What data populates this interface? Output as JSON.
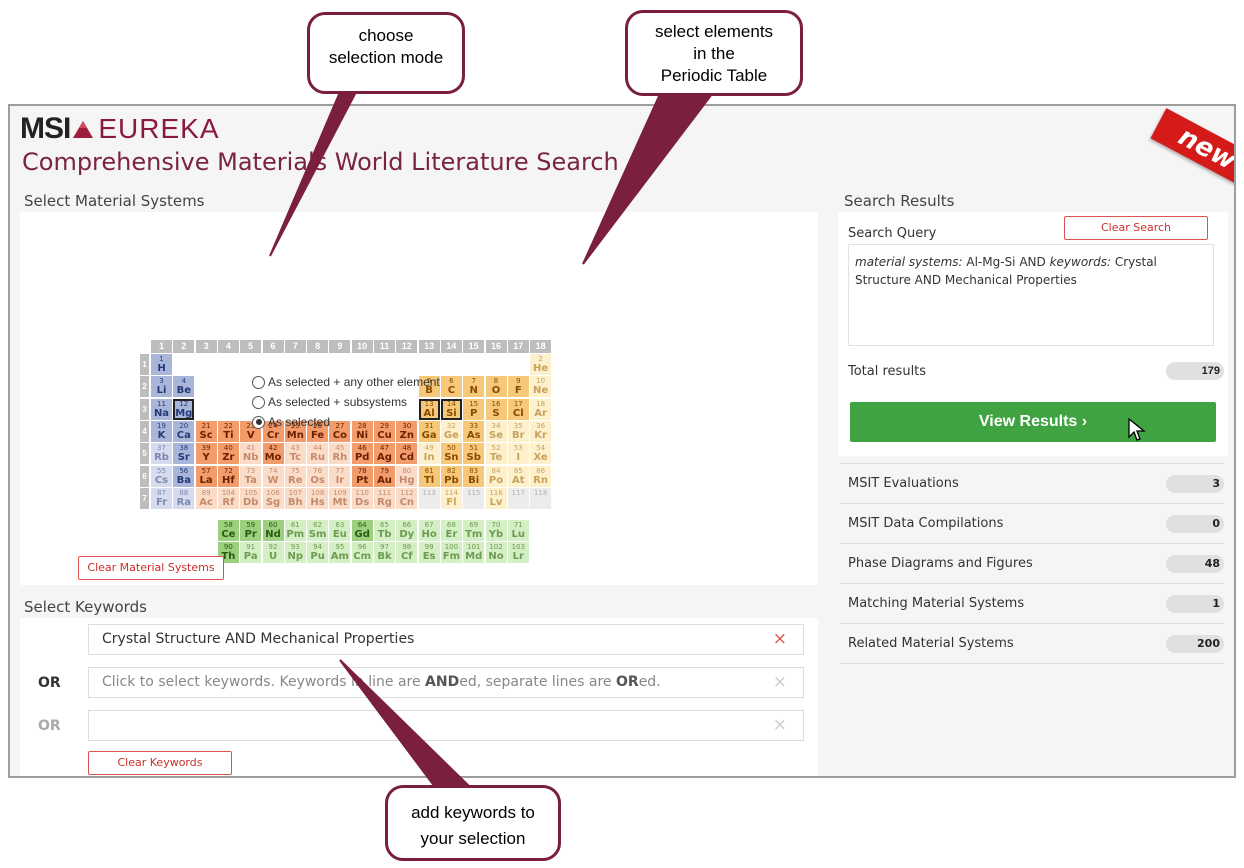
{
  "app": {
    "logo_msi": "MSI",
    "logo_eureka": "EUREKA",
    "tagline": "Comprehensive Materials World Literature Search",
    "badge": "new"
  },
  "material_systems": {
    "title": "Select Material Systems",
    "clear_label": "Clear Material Systems",
    "modes": [
      {
        "label": "As selected + any other element",
        "selected": false
      },
      {
        "label": "As selected + subsystems",
        "selected": false
      },
      {
        "label": "As selected",
        "selected": true
      }
    ],
    "group_numbers": [
      "1",
      "2",
      "3",
      "4",
      "5",
      "6",
      "7",
      "8",
      "9",
      "10",
      "11",
      "12",
      "13",
      "14",
      "15",
      "16",
      "17",
      "18"
    ],
    "period_numbers": [
      "1",
      "2",
      "3",
      "4",
      "5",
      "6",
      "7"
    ],
    "selected_elements": [
      "Mg",
      "Al",
      "Si"
    ],
    "elements": [
      {
        "z": "1",
        "sym": "H",
        "row": 1,
        "col": 1,
        "cat": "blue"
      },
      {
        "z": "2",
        "sym": "He",
        "row": 1,
        "col": 18,
        "cat": "yellowlt"
      },
      {
        "z": "3",
        "sym": "Li",
        "row": 2,
        "col": 1,
        "cat": "blue"
      },
      {
        "z": "4",
        "sym": "Be",
        "row": 2,
        "col": 2,
        "cat": "blue"
      },
      {
        "z": "5",
        "sym": "B",
        "row": 2,
        "col": 13,
        "cat": "yellow"
      },
      {
        "z": "6",
        "sym": "C",
        "row": 2,
        "col": 14,
        "cat": "yellow"
      },
      {
        "z": "7",
        "sym": "N",
        "row": 2,
        "col": 15,
        "cat": "yellow"
      },
      {
        "z": "8",
        "sym": "O",
        "row": 2,
        "col": 16,
        "cat": "yellow"
      },
      {
        "z": "9",
        "sym": "F",
        "row": 2,
        "col": 17,
        "cat": "yellow"
      },
      {
        "z": "10",
        "sym": "Ne",
        "row": 2,
        "col": 18,
        "cat": "yellowlt"
      },
      {
        "z": "11",
        "sym": "Na",
        "row": 3,
        "col": 1,
        "cat": "blue"
      },
      {
        "z": "12",
        "sym": "Mg",
        "row": 3,
        "col": 2,
        "cat": "blue"
      },
      {
        "z": "13",
        "sym": "Al",
        "row": 3,
        "col": 13,
        "cat": "yellow"
      },
      {
        "z": "14",
        "sym": "Si",
        "row": 3,
        "col": 14,
        "cat": "yellow"
      },
      {
        "z": "15",
        "sym": "P",
        "row": 3,
        "col": 15,
        "cat": "yellow"
      },
      {
        "z": "16",
        "sym": "S",
        "row": 3,
        "col": 16,
        "cat": "yellow"
      },
      {
        "z": "17",
        "sym": "Cl",
        "row": 3,
        "col": 17,
        "cat": "yellow"
      },
      {
        "z": "18",
        "sym": "Ar",
        "row": 3,
        "col": 18,
        "cat": "yellowlt"
      },
      {
        "z": "19",
        "sym": "K",
        "row": 4,
        "col": 1,
        "cat": "blue"
      },
      {
        "z": "20",
        "sym": "Ca",
        "row": 4,
        "col": 2,
        "cat": "blue"
      },
      {
        "z": "21",
        "sym": "Sc",
        "row": 4,
        "col": 3,
        "cat": "orange"
      },
      {
        "z": "22",
        "sym": "Ti",
        "row": 4,
        "col": 4,
        "cat": "orange"
      },
      {
        "z": "23",
        "sym": "V",
        "row": 4,
        "col": 5,
        "cat": "orange"
      },
      {
        "z": "24",
        "sym": "Cr",
        "row": 4,
        "col": 6,
        "cat": "orange"
      },
      {
        "z": "25",
        "sym": "Mn",
        "row": 4,
        "col": 7,
        "cat": "orange"
      },
      {
        "z": "26",
        "sym": "Fe",
        "row": 4,
        "col": 8,
        "cat": "orange"
      },
      {
        "z": "27",
        "sym": "Co",
        "row": 4,
        "col": 9,
        "cat": "orange"
      },
      {
        "z": "28",
        "sym": "Ni",
        "row": 4,
        "col": 10,
        "cat": "orange"
      },
      {
        "z": "29",
        "sym": "Cu",
        "row": 4,
        "col": 11,
        "cat": "orange"
      },
      {
        "z": "30",
        "sym": "Zn",
        "row": 4,
        "col": 12,
        "cat": "orange"
      },
      {
        "z": "31",
        "sym": "Ga",
        "row": 4,
        "col": 13,
        "cat": "yellow"
      },
      {
        "z": "32",
        "sym": "Ge",
        "row": 4,
        "col": 14,
        "cat": "yellowlt"
      },
      {
        "z": "33",
        "sym": "As",
        "row": 4,
        "col": 15,
        "cat": "yellow"
      },
      {
        "z": "34",
        "sym": "Se",
        "row": 4,
        "col": 16,
        "cat": "yellowlt"
      },
      {
        "z": "35",
        "sym": "Br",
        "row": 4,
        "col": 17,
        "cat": "yellowlt"
      },
      {
        "z": "36",
        "sym": "Kr",
        "row": 4,
        "col": 18,
        "cat": "yellowlt"
      },
      {
        "z": "37",
        "sym": "Rb",
        "row": 5,
        "col": 1,
        "cat": "bluelt"
      },
      {
        "z": "38",
        "sym": "Sr",
        "row": 5,
        "col": 2,
        "cat": "blue"
      },
      {
        "z": "39",
        "sym": "Y",
        "row": 5,
        "col": 3,
        "cat": "orange"
      },
      {
        "z": "40",
        "sym": "Zr",
        "row": 5,
        "col": 4,
        "cat": "orange"
      },
      {
        "z": "41",
        "sym": "Nb",
        "row": 5,
        "col": 5,
        "cat": "orangelt"
      },
      {
        "z": "42",
        "sym": "Mo",
        "row": 5,
        "col": 6,
        "cat": "orange"
      },
      {
        "z": "43",
        "sym": "Tc",
        "row": 5,
        "col": 7,
        "cat": "orangelt"
      },
      {
        "z": "44",
        "sym": "Ru",
        "row": 5,
        "col": 8,
        "cat": "orangelt"
      },
      {
        "z": "45",
        "sym": "Rh",
        "row": 5,
        "col": 9,
        "cat": "orangelt"
      },
      {
        "z": "46",
        "sym": "Pd",
        "row": 5,
        "col": 10,
        "cat": "orange"
      },
      {
        "z": "47",
        "sym": "Ag",
        "row": 5,
        "col": 11,
        "cat": "orange"
      },
      {
        "z": "48",
        "sym": "Cd",
        "row": 5,
        "col": 12,
        "cat": "orange"
      },
      {
        "z": "49",
        "sym": "In",
        "row": 5,
        "col": 13,
        "cat": "yellowlt"
      },
      {
        "z": "50",
        "sym": "Sn",
        "row": 5,
        "col": 14,
        "cat": "yellow"
      },
      {
        "z": "51",
        "sym": "Sb",
        "row": 5,
        "col": 15,
        "cat": "yellow"
      },
      {
        "z": "52",
        "sym": "Te",
        "row": 5,
        "col": 16,
        "cat": "yellowlt"
      },
      {
        "z": "53",
        "sym": "I",
        "row": 5,
        "col": 17,
        "cat": "yellowlt"
      },
      {
        "z": "54",
        "sym": "Xe",
        "row": 5,
        "col": 18,
        "cat": "yellowlt"
      },
      {
        "z": "55",
        "sym": "Cs",
        "row": 6,
        "col": 1,
        "cat": "bluelt"
      },
      {
        "z": "56",
        "sym": "Ba",
        "row": 6,
        "col": 2,
        "cat": "blue"
      },
      {
        "z": "57",
        "sym": "La",
        "row": 6,
        "col": 3,
        "cat": "orange"
      },
      {
        "z": "72",
        "sym": "Hf",
        "row": 6,
        "col": 4,
        "cat": "orange"
      },
      {
        "z": "73",
        "sym": "Ta",
        "row": 6,
        "col": 5,
        "cat": "orangelt"
      },
      {
        "z": "74",
        "sym": "W",
        "row": 6,
        "col": 6,
        "cat": "orangelt"
      },
      {
        "z": "75",
        "sym": "Re",
        "row": 6,
        "col": 7,
        "cat": "orangelt"
      },
      {
        "z": "76",
        "sym": "Os",
        "row": 6,
        "col": 8,
        "cat": "orangelt"
      },
      {
        "z": "77",
        "sym": "Ir",
        "row": 6,
        "col": 9,
        "cat": "orangelt"
      },
      {
        "z": "78",
        "sym": "Pt",
        "row": 6,
        "col": 10,
        "cat": "orange"
      },
      {
        "z": "79",
        "sym": "Au",
        "row": 6,
        "col": 11,
        "cat": "orange"
      },
      {
        "z": "80",
        "sym": "Hg",
        "row": 6,
        "col": 12,
        "cat": "orangelt"
      },
      {
        "z": "81",
        "sym": "Tl",
        "row": 6,
        "col": 13,
        "cat": "yellow"
      },
      {
        "z": "82",
        "sym": "Pb",
        "row": 6,
        "col": 14,
        "cat": "yellow"
      },
      {
        "z": "83",
        "sym": "Bi",
        "row": 6,
        "col": 15,
        "cat": "yellow"
      },
      {
        "z": "84",
        "sym": "Po",
        "row": 6,
        "col": 16,
        "cat": "yellowlt"
      },
      {
        "z": "85",
        "sym": "At",
        "row": 6,
        "col": 17,
        "cat": "yellowlt"
      },
      {
        "z": "86",
        "sym": "Rn",
        "row": 6,
        "col": 18,
        "cat": "yellowlt"
      },
      {
        "z": "87",
        "sym": "Fr",
        "row": 7,
        "col": 1,
        "cat": "bluelt"
      },
      {
        "z": "88",
        "sym": "Ra",
        "row": 7,
        "col": 2,
        "cat": "bluelt"
      },
      {
        "z": "89",
        "sym": "Ac",
        "row": 7,
        "col": 3,
        "cat": "orangelt"
      },
      {
        "z": "104",
        "sym": "Rf",
        "row": 7,
        "col": 4,
        "cat": "orangelt"
      },
      {
        "z": "105",
        "sym": "Db",
        "row": 7,
        "col": 5,
        "cat": "orangelt"
      },
      {
        "z": "106",
        "sym": "Sg",
        "row": 7,
        "col": 6,
        "cat": "orangelt"
      },
      {
        "z": "107",
        "sym": "Bh",
        "row": 7,
        "col": 7,
        "cat": "orangelt"
      },
      {
        "z": "108",
        "sym": "Hs",
        "row": 7,
        "col": 8,
        "cat": "orangelt"
      },
      {
        "z": "109",
        "sym": "Mt",
        "row": 7,
        "col": 9,
        "cat": "orangelt"
      },
      {
        "z": "110",
        "sym": "Ds",
        "row": 7,
        "col": 10,
        "cat": "orangelt"
      },
      {
        "z": "111",
        "sym": "Rg",
        "row": 7,
        "col": 11,
        "cat": "orangelt"
      },
      {
        "z": "112",
        "sym": "Cn",
        "row": 7,
        "col": 12,
        "cat": "orangelt"
      },
      {
        "z": "113",
        "sym": "",
        "row": 7,
        "col": 13,
        "cat": "grey"
      },
      {
        "z": "114",
        "sym": "Fl",
        "row": 7,
        "col": 14,
        "cat": "yellowlt"
      },
      {
        "z": "115",
        "sym": "",
        "row": 7,
        "col": 15,
        "cat": "grey"
      },
      {
        "z": "116",
        "sym": "Lv",
        "row": 7,
        "col": 16,
        "cat": "yellowlt"
      },
      {
        "z": "117",
        "sym": "",
        "row": 7,
        "col": 17,
        "cat": "grey"
      },
      {
        "z": "118",
        "sym": "",
        "row": 7,
        "col": 18,
        "cat": "grey"
      },
      {
        "z": "58",
        "sym": "Ce",
        "row": 9,
        "col": 4,
        "cat": "green"
      },
      {
        "z": "59",
        "sym": "Pr",
        "row": 9,
        "col": 5,
        "cat": "green"
      },
      {
        "z": "60",
        "sym": "Nd",
        "row": 9,
        "col": 6,
        "cat": "green"
      },
      {
        "z": "61",
        "sym": "Pm",
        "row": 9,
        "col": 7,
        "cat": "greenlt"
      },
      {
        "z": "62",
        "sym": "Sm",
        "row": 9,
        "col": 8,
        "cat": "greenlt"
      },
      {
        "z": "63",
        "sym": "Eu",
        "row": 9,
        "col": 9,
        "cat": "greenlt"
      },
      {
        "z": "64",
        "sym": "Gd",
        "row": 9,
        "col": 10,
        "cat": "green"
      },
      {
        "z": "65",
        "sym": "Tb",
        "row": 9,
        "col": 11,
        "cat": "greenlt"
      },
      {
        "z": "66",
        "sym": "Dy",
        "row": 9,
        "col": 12,
        "cat": "greenlt"
      },
      {
        "z": "67",
        "sym": "Ho",
        "row": 9,
        "col": 13,
        "cat": "greenlt"
      },
      {
        "z": "68",
        "sym": "Er",
        "row": 9,
        "col": 14,
        "cat": "greenlt"
      },
      {
        "z": "69",
        "sym": "Tm",
        "row": 9,
        "col": 15,
        "cat": "greenlt"
      },
      {
        "z": "70",
        "sym": "Yb",
        "row": 9,
        "col": 16,
        "cat": "greenlt"
      },
      {
        "z": "71",
        "sym": "Lu",
        "row": 9,
        "col": 17,
        "cat": "greenlt"
      },
      {
        "z": "90",
        "sym": "Th",
        "row": 10,
        "col": 4,
        "cat": "green"
      },
      {
        "z": "91",
        "sym": "Pa",
        "row": 10,
        "col": 5,
        "cat": "greenlt"
      },
      {
        "z": "92",
        "sym": "U",
        "row": 10,
        "col": 6,
        "cat": "greenlt"
      },
      {
        "z": "93",
        "sym": "Np",
        "row": 10,
        "col": 7,
        "cat": "greenlt"
      },
      {
        "z": "94",
        "sym": "Pu",
        "row": 10,
        "col": 8,
        "cat": "greenlt"
      },
      {
        "z": "95",
        "sym": "Am",
        "row": 10,
        "col": 9,
        "cat": "greenlt"
      },
      {
        "z": "96",
        "sym": "Cm",
        "row": 10,
        "col": 10,
        "cat": "greenlt"
      },
      {
        "z": "97",
        "sym": "Bk",
        "row": 10,
        "col": 11,
        "cat": "greenlt"
      },
      {
        "z": "98",
        "sym": "Cf",
        "row": 10,
        "col": 12,
        "cat": "greenlt"
      },
      {
        "z": "99",
        "sym": "Es",
        "row": 10,
        "col": 13,
        "cat": "greenlt"
      },
      {
        "z": "100",
        "sym": "Fm",
        "row": 10,
        "col": 14,
        "cat": "greenlt"
      },
      {
        "z": "101",
        "sym": "Md",
        "row": 10,
        "col": 15,
        "cat": "greenlt"
      },
      {
        "z": "102",
        "sym": "No",
        "row": 10,
        "col": 16,
        "cat": "greenlt"
      },
      {
        "z": "103",
        "sym": "Lr",
        "row": 10,
        "col": 17,
        "cat": "greenlt"
      }
    ],
    "colors": {
      "blue": {
        "bg": "#a9b6d9",
        "fg": "#243a78"
      },
      "bluelt": {
        "bg": "#d6dcee",
        "fg": "#7b88b0"
      },
      "orange": {
        "bg": "#f39c6b",
        "fg": "#6b2100"
      },
      "orangelt": {
        "bg": "#fbdcc8",
        "fg": "#c48a6c"
      },
      "yellow": {
        "bg": "#f6c97a",
        "fg": "#8a4a00"
      },
      "yellowlt": {
        "bg": "#fdf0cd",
        "fg": "#c8a25c"
      },
      "green": {
        "bg": "#9ccf7e",
        "fg": "#2b5a14"
      },
      "greenlt": {
        "bg": "#d5efc4",
        "fg": "#6c9b52"
      },
      "grey": {
        "bg": "#ececec",
        "fg": "#b0b0b0"
      }
    }
  },
  "keywords": {
    "title": "Select Keywords",
    "or_label": "OR",
    "lines": [
      {
        "value": "Crystal Structure AND Mechanical Properties",
        "placeholder": ""
      },
      {
        "value": "",
        "placeholder_parts": [
          "Click to select keywords. Keywords in line are ",
          "AND",
          "ed, separate lines are ",
          "OR",
          "ed."
        ]
      },
      {
        "value": "",
        "placeholder": ""
      }
    ],
    "clear_label": "Clear Keywords",
    "remove_glyph": "×"
  },
  "search_results": {
    "title": "Search Results",
    "query_label": "Search Query",
    "clear_label": "Clear Search",
    "query_prefix_1": "material systems:",
    "query_value_1": " Al-Mg-Si AND ",
    "query_prefix_2": "keywords:",
    "query_value_2": " Crystal Structure AND Mechanical Properties",
    "total_label": "Total results",
    "total_count": "179",
    "view_label": "View Results ›",
    "categories": [
      {
        "label": "MSIT Evaluations",
        "count": "3"
      },
      {
        "label": "MSIT Data Compilations",
        "count": "0"
      },
      {
        "label": "Phase Diagrams and Figures",
        "count": "48"
      },
      {
        "label": "Matching Material Systems",
        "count": "1"
      },
      {
        "label": "Related Material Systems",
        "count": "200"
      }
    ],
    "accent_color": "#3ea340"
  },
  "callouts": {
    "mode": "choose\nselection mode",
    "elements": "select elements\nin the\nPeriodic Table",
    "keywords": "add keywords to\nyour selection"
  }
}
